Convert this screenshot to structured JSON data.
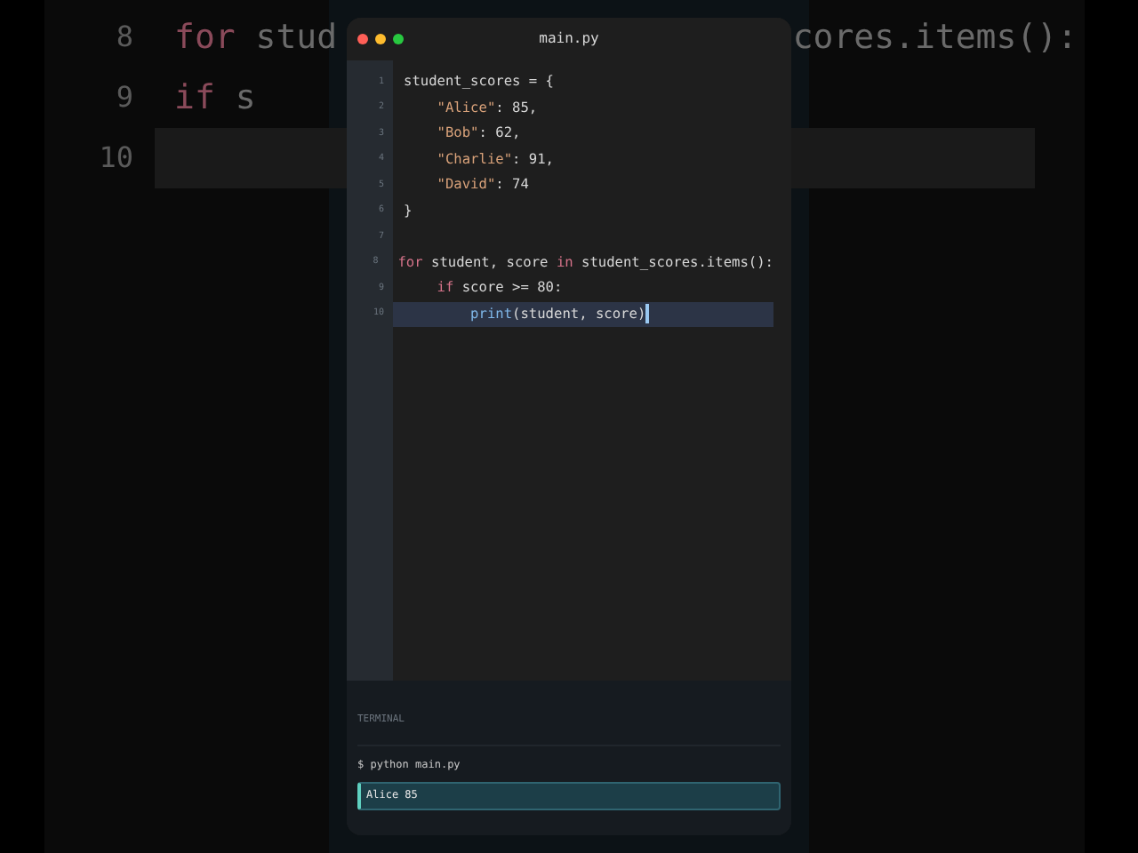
{
  "backdrop": {
    "lines": [
      {
        "number": "8",
        "left": [
          {
            "kind": "keyword",
            "text": "for"
          },
          {
            "kind": "plain",
            "text": " stud"
          }
        ],
        "right": "cores.items():",
        "selected": false
      },
      {
        "number": "9",
        "left": [
          {
            "kind": "keyword",
            "text": "if"
          },
          {
            "kind": "plain",
            "text": " s"
          }
        ],
        "selected": false
      },
      {
        "number": "10",
        "selected": true
      }
    ]
  },
  "window": {
    "title": "main.py"
  },
  "editor": {
    "lines": [
      {
        "number": "1",
        "selected": false,
        "cursor": false,
        "tokens": [
          {
            "kind": "plain",
            "text": "student_scores = {"
          }
        ]
      },
      {
        "number": "2",
        "selected": false,
        "cursor": false,
        "tokens": [
          {
            "kind": "string",
            "text": "    \"Alice\""
          },
          {
            "kind": "plain",
            "text": ": 85,"
          }
        ]
      },
      {
        "number": "3",
        "selected": false,
        "cursor": false,
        "tokens": [
          {
            "kind": "string",
            "text": "    \"Bob\""
          },
          {
            "kind": "plain",
            "text": ": 62,"
          }
        ]
      },
      {
        "number": "4",
        "selected": false,
        "cursor": false,
        "tokens": [
          {
            "kind": "string",
            "text": "    \"Charlie\""
          },
          {
            "kind": "plain",
            "text": ": 91,"
          }
        ]
      },
      {
        "number": "5",
        "selected": false,
        "cursor": false,
        "tokens": [
          {
            "kind": "string",
            "text": "    \"David\""
          },
          {
            "kind": "plain",
            "text": ": 74"
          }
        ]
      },
      {
        "number": "6",
        "selected": false,
        "cursor": false,
        "tokens": [
          {
            "kind": "plain",
            "text": "}"
          }
        ]
      },
      {
        "number": "7",
        "selected": false,
        "cursor": false
      },
      {
        "number": "8",
        "selected": false,
        "cursor": false,
        "tokens": [
          {
            "kind": "keyword",
            "text": "for"
          },
          {
            "kind": "plain",
            "text": " student, score "
          },
          {
            "kind": "keyword",
            "text": "in"
          },
          {
            "kind": "plain",
            "text": " student_scores.items():"
          }
        ]
      },
      {
        "number": "9",
        "selected": false,
        "cursor": false,
        "tokens": [
          {
            "kind": "keyword",
            "text": "    if"
          },
          {
            "kind": "plain",
            "text": " score >= 80:"
          }
        ]
      },
      {
        "number": "10",
        "selected": true,
        "cursor": true,
        "tokens": [
          {
            "kind": "function",
            "text": "        print"
          },
          {
            "kind": "plain",
            "text": "(student, score)"
          }
        ]
      }
    ]
  },
  "terminal": {
    "title": "TERMINAL",
    "command": "$ python main.py",
    "outputs": [
      {
        "text": "Alice 85",
        "selected": true
      }
    ]
  }
}
